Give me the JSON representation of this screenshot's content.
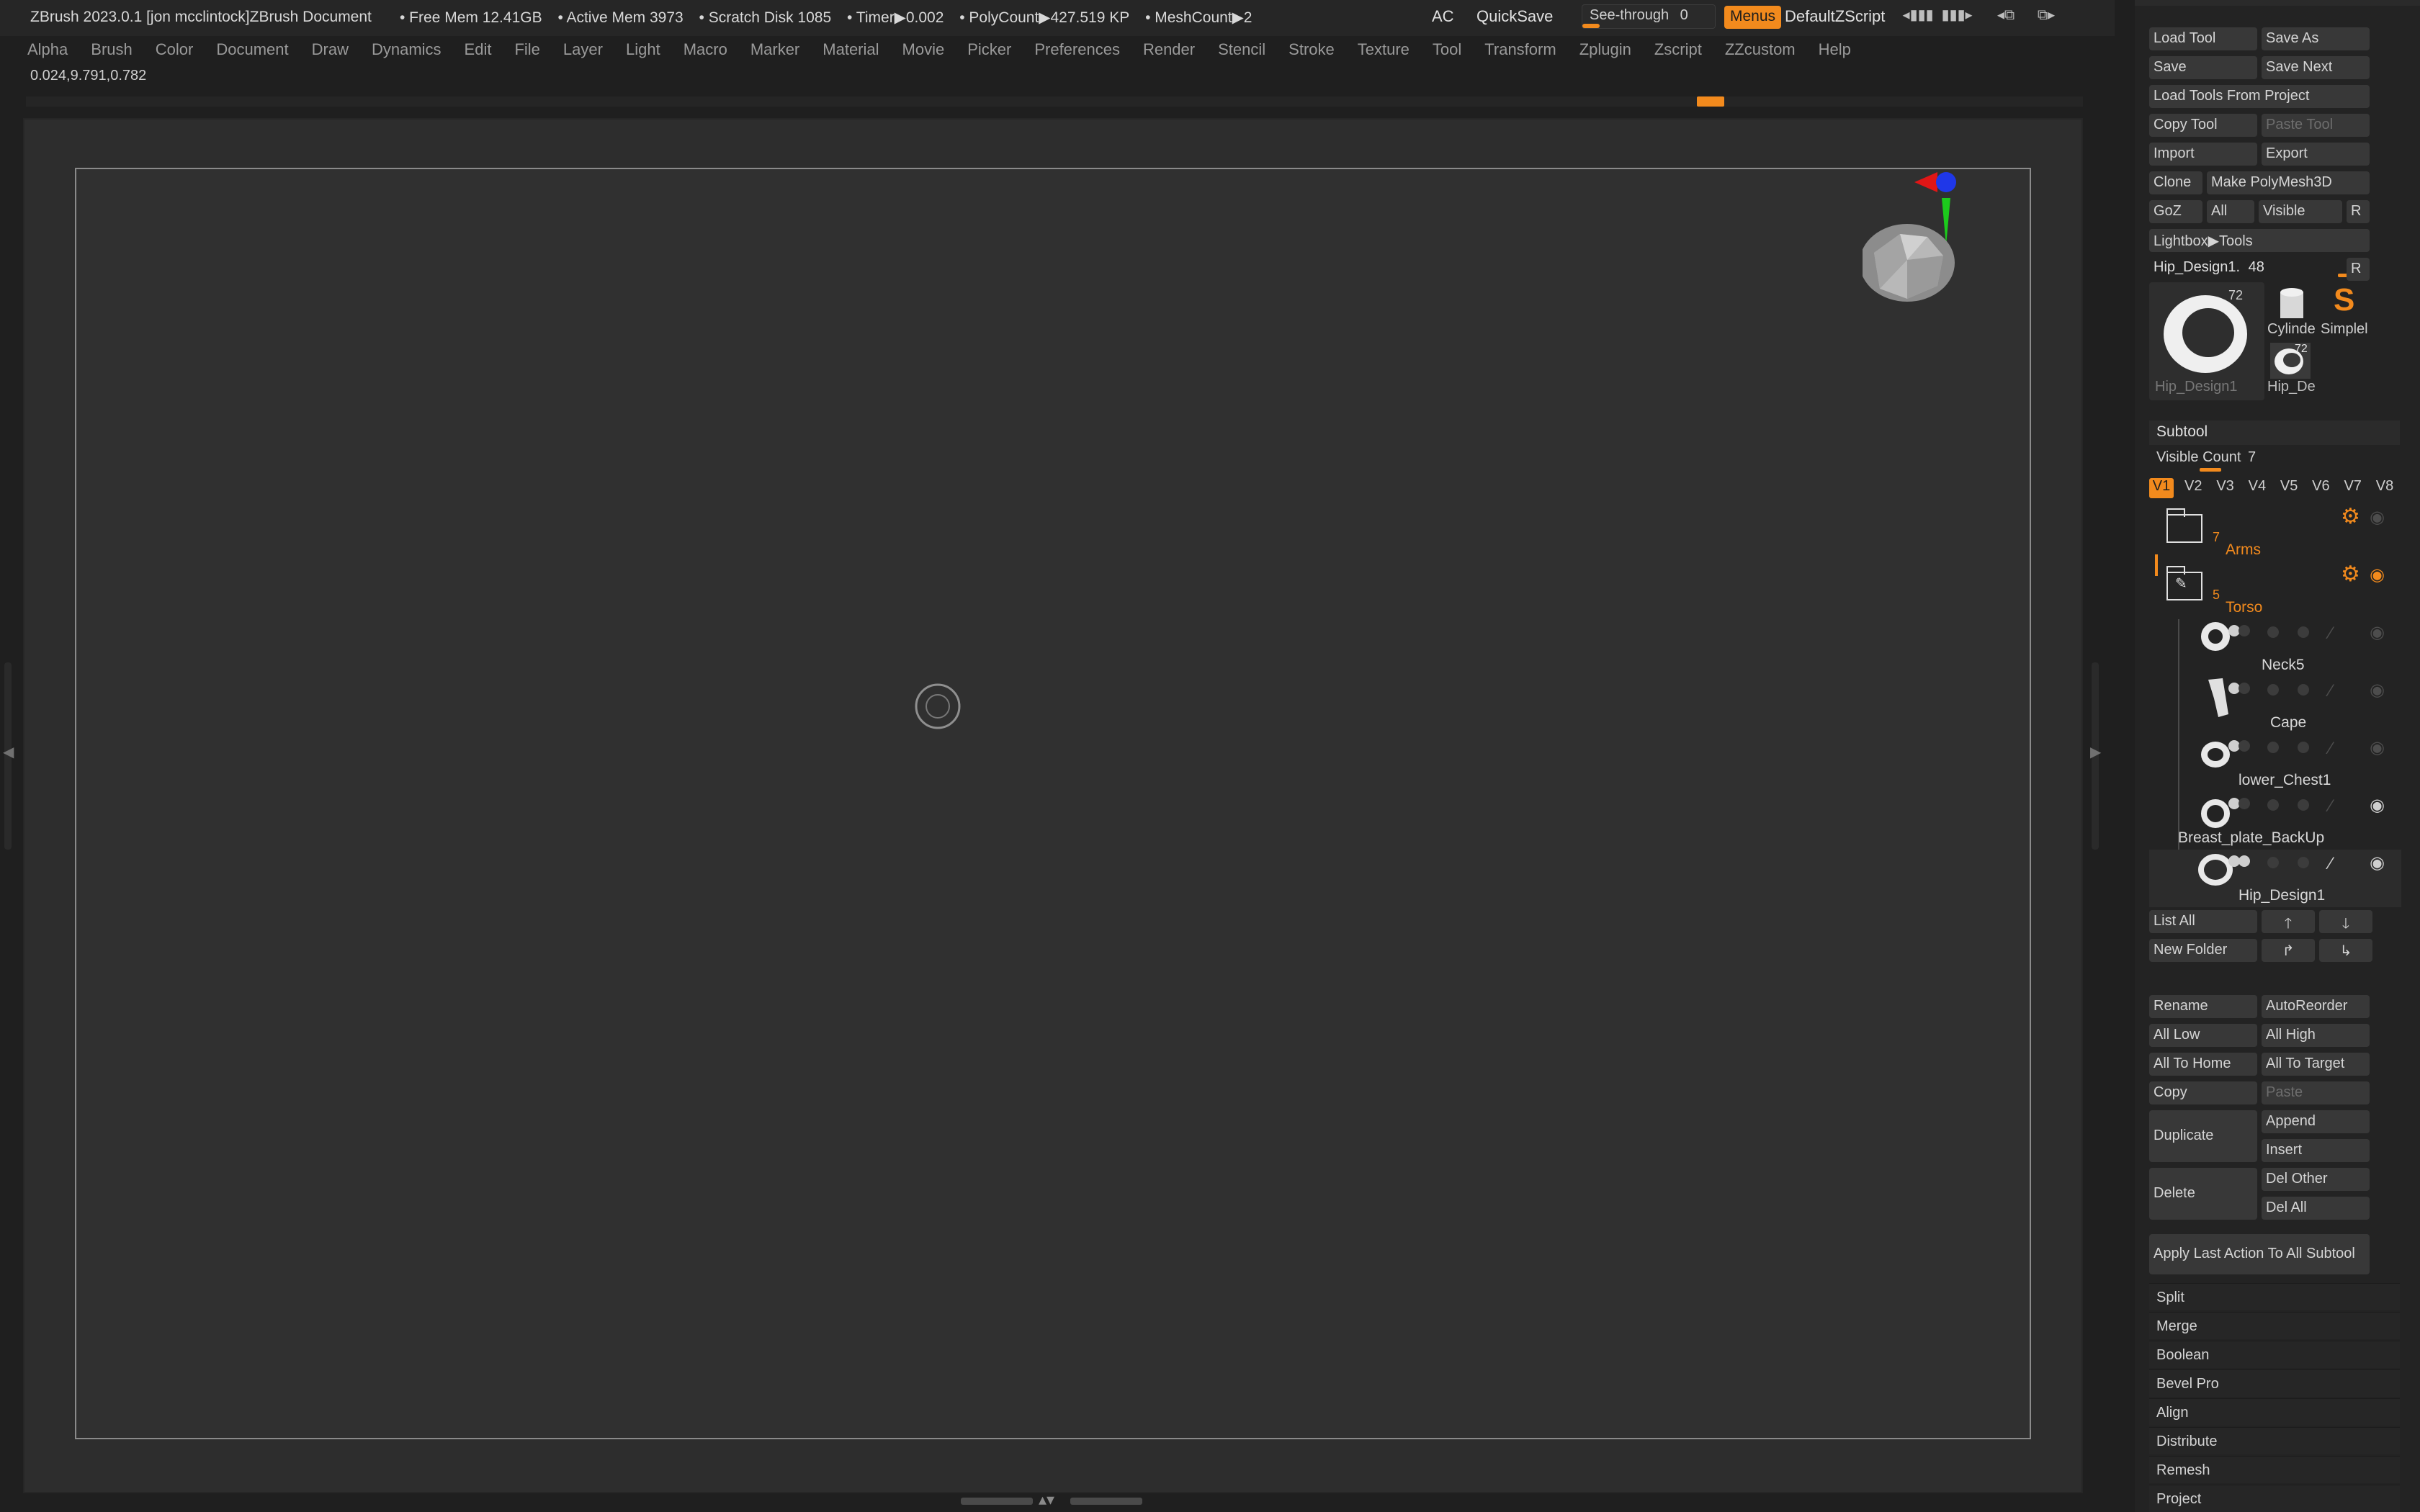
{
  "titlebar": {
    "title": "ZBrush 2023.0.1 [jon mcclintock]ZBrush Document",
    "stats": [
      "• Free Mem 12.41GB",
      "• Active Mem 3973",
      "• Scratch Disk 1085",
      "• Timer▶0.002",
      "• PolyCount▶427.519 KP",
      "• MeshCount▶2"
    ],
    "ac": "AC",
    "quicksave": "QuickSave",
    "seethrough_label": "See-through",
    "seethrough_value": "0",
    "menus": "Menus",
    "zscript": "DefaultZScript"
  },
  "menubar": [
    "Alpha",
    "Brush",
    "Color",
    "Document",
    "Draw",
    "Dynamics",
    "Edit",
    "File",
    "Layer",
    "Light",
    "Macro",
    "Marker",
    "Material",
    "Movie",
    "Picker",
    "Preferences",
    "Render",
    "Stencil",
    "Stroke",
    "Texture",
    "Tool",
    "Transform",
    "Zplugin",
    "Zscript",
    "ZZcustom",
    "Help"
  ],
  "coords": "0.024,9.791,0.782",
  "tool": {
    "load_tool": "Load Tool",
    "save_as": "Save As",
    "save": "Save",
    "save_next": "Save Next",
    "load_from_project": "Load Tools From Project",
    "copy_tool": "Copy Tool",
    "paste_tool": "Paste Tool",
    "import": "Import",
    "export": "Export",
    "clone": "Clone",
    "make_polymesh": "Make PolyMesh3D",
    "goz": "GoZ",
    "all": "All",
    "visible": "Visible",
    "r": "R",
    "lightbox_tools": "Lightbox▶Tools",
    "current_tool": "Hip_Design1.",
    "current_tool_value": "48",
    "thumb_main_label": "Hip_Design1",
    "thumb_main_count": "72",
    "thumb_cylinder": "Cylinde",
    "thumb_simple": "Simplel",
    "thumb_hip_de": "Hip_De",
    "thumb_hip_de_count": "72"
  },
  "subtool": {
    "header": "Subtool",
    "visible_count_label": "Visible Count",
    "visible_count": "7",
    "vtabs": [
      "V1",
      "V2",
      "V3",
      "V4",
      "V5",
      "V6",
      "V7",
      "V8"
    ],
    "items": [
      {
        "name": "Arms",
        "count": "7",
        "type": "folder"
      },
      {
        "name": "Torso",
        "count": "5",
        "type": "folder-open"
      },
      {
        "name": "Neck5",
        "type": "mesh"
      },
      {
        "name": "Cape",
        "type": "mesh"
      },
      {
        "name": "lower_Chest1",
        "type": "mesh"
      },
      {
        "name": "Breast_plate_BackUp",
        "type": "mesh"
      },
      {
        "name": "Hip_Design1",
        "type": "mesh"
      }
    ],
    "list_all": "List All",
    "new_folder": "New Folder",
    "rename": "Rename",
    "autoreorder": "AutoReorder",
    "all_low": "All Low",
    "all_high": "All High",
    "all_to_home": "All To Home",
    "all_to_target": "All To Target",
    "copy": "Copy",
    "paste": "Paste",
    "duplicate": "Duplicate",
    "append": "Append",
    "insert": "Insert",
    "delete": "Delete",
    "del_other": "Del Other",
    "del_all": "Del All",
    "apply_last": "Apply Last Action To All Subtool",
    "sections": [
      "Split",
      "Merge",
      "Boolean",
      "Bevel Pro",
      "Align",
      "Distribute",
      "Remesh",
      "Project"
    ]
  },
  "colors": {
    "accent": "#f28a1d",
    "canvas": "#303030",
    "panel": "#232323"
  }
}
